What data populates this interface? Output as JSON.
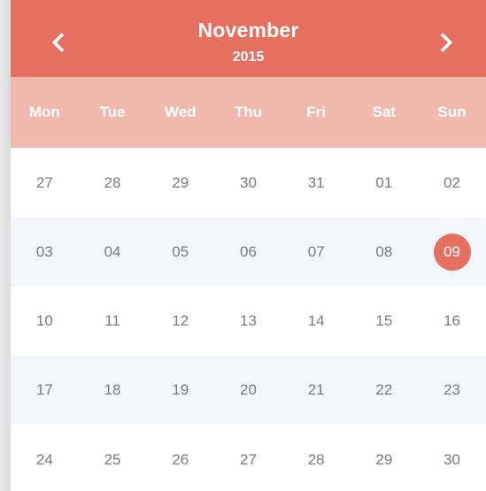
{
  "header": {
    "month": "November",
    "year": "2015",
    "prev_icon": "chevron-left-icon",
    "next_icon": "chevron-right-icon"
  },
  "weekdays": [
    "Mon",
    "Tue",
    "Wed",
    "Thu",
    "Fri",
    "Sat",
    "Sun"
  ],
  "weeks": [
    [
      "27",
      "28",
      "29",
      "30",
      "31",
      "01",
      "02"
    ],
    [
      "03",
      "04",
      "05",
      "06",
      "07",
      "08",
      "09"
    ],
    [
      "10",
      "11",
      "12",
      "13",
      "14",
      "15",
      "16"
    ],
    [
      "17",
      "18",
      "19",
      "20",
      "21",
      "22",
      "23"
    ],
    [
      "24",
      "25",
      "26",
      "27",
      "28",
      "29",
      "30"
    ]
  ],
  "selected": {
    "week": 1,
    "day": 6
  },
  "colors": {
    "accent": "#e5705f",
    "weekday_bar": "#f2b7ae",
    "row_alt": "#f3f7fc",
    "day_text": "#7a7a7a"
  }
}
